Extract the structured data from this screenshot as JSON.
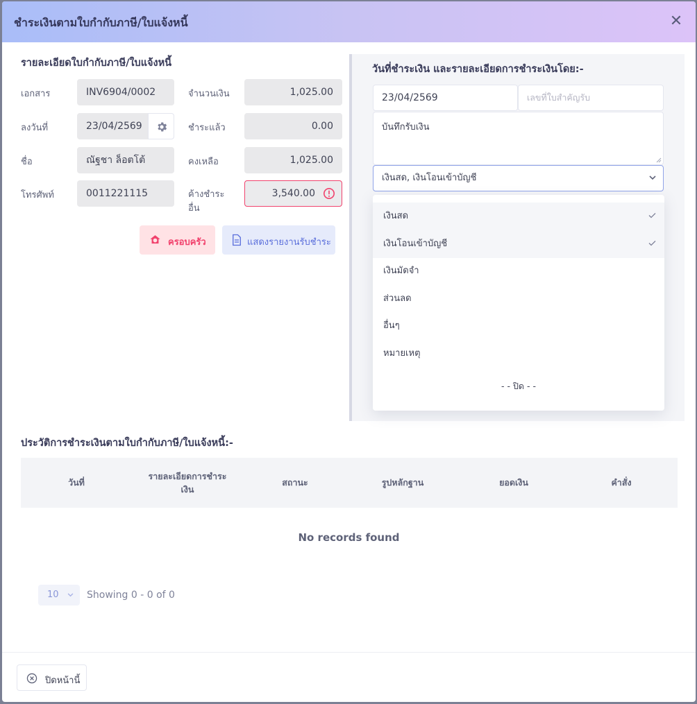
{
  "modal": {
    "title": "ชำระเงินตามใบกำกับภาษี/ใบแจ้งหนี้",
    "close_symbol": "✕"
  },
  "invoice": {
    "section_title": "รายละเอียดใบกำกับภาษี/ใบแจ้งหนี้",
    "doc_label": "เอกสาร",
    "doc_value": "INV6904/0002",
    "date_label": "ลงวันที่",
    "date_value": "23/04/2569",
    "name_label": "ชื่อ",
    "name_value": "ณัฐชา ล็อตโต้",
    "phone_label": "โทรศัพท์",
    "phone_value": "0011221115",
    "amount_label": "จำนวนเงิน",
    "amount_value": "1,025.00",
    "paid_label": "ชำระแล้ว",
    "paid_value": "0.00",
    "remaining_label": "คงเหลือ",
    "remaining_value": "1,025.00",
    "other_due_label_1": "ค้างชำระ",
    "other_due_label_2": "อื่น",
    "other_due_value": "3,540.00",
    "family_button": "ครอบครัว",
    "report_button": "แสดงรายงานรับชำระ"
  },
  "payment": {
    "section_title": "วันที่ชำระเงิน และรายละเอียดการชำระเงินโดย:-",
    "date_value": "23/04/2569",
    "receipt_placeholder": "เลขที่ใบสำคัญรับ",
    "note_value": "บันทึกรับเงิน",
    "method_value": "เงินสด, เงินโอนเข้าบัญชี",
    "options": [
      {
        "label": "เงินสด",
        "selected": true
      },
      {
        "label": "เงินโอนเข้าบัญชี",
        "selected": true
      },
      {
        "label": "เงินมัดจำ",
        "selected": false
      },
      {
        "label": "ส่วนลด",
        "selected": false
      },
      {
        "label": "อื่นๆ",
        "selected": false
      },
      {
        "label": "หมายเหตุ",
        "selected": false
      }
    ],
    "close_option": "- - ปิด - -"
  },
  "history": {
    "section_title": "ประวัติการชำระเงินตามใบกำกับภาษี/ใบแจ้งหนี้:-",
    "columns": [
      "วันที่",
      "รายละเอียดการชำระ",
      "เงิน",
      "สถานะ",
      "รูปหลักฐาน",
      "ยอดเงิน",
      "คำสั่ง"
    ],
    "empty_text": "No records found",
    "page_size": "10",
    "showing_text": "Showing 0 - 0 of 0"
  },
  "footer": {
    "close_page_button": "ปิดหน้านี้"
  },
  "colors": {
    "accent": "#5a6edb",
    "danger": "#f1416c",
    "header_gradient_start": "#a9bdf8",
    "header_gradient_end": "#dcc3f8"
  }
}
